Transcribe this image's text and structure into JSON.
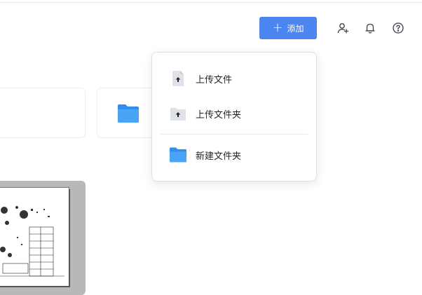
{
  "header": {
    "add_label": "添加",
    "icons": [
      "add-member-icon",
      "bell-icon",
      "help-icon"
    ]
  },
  "dropdown": {
    "items": [
      {
        "label": "上传文件",
        "icon": "upload-file-icon"
      },
      {
        "label": "上传文件夹",
        "icon": "upload-folder-icon"
      },
      {
        "label": "新建文件夹",
        "icon": "new-folder-icon"
      }
    ]
  },
  "colors": {
    "primary": "#4b86f0",
    "folder": "#4aa3f5",
    "doc": "#dfe2e8"
  }
}
